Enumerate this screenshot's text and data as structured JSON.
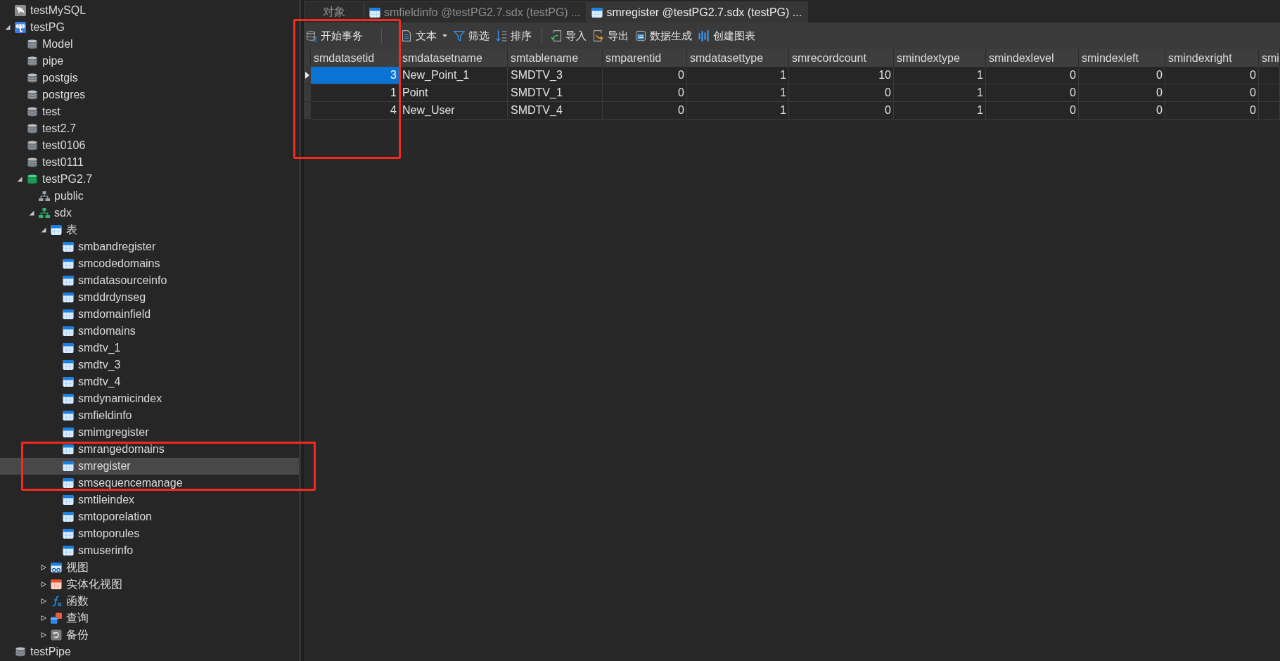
{
  "sidebar": {
    "tree": [
      {
        "label": "testMySQL",
        "kind": "mysql",
        "selected": false
      },
      {
        "label": "testPG",
        "kind": "postgres",
        "expanded": true,
        "selected": false,
        "children": [
          {
            "label": "Model",
            "kind": "database",
            "open": false,
            "selected": false
          },
          {
            "label": "pipe",
            "kind": "database",
            "open": false,
            "selected": false
          },
          {
            "label": "postgis",
            "kind": "database",
            "open": false,
            "selected": false
          },
          {
            "label": "postgres",
            "kind": "database",
            "open": false,
            "selected": false
          },
          {
            "label": "test",
            "kind": "database",
            "open": false,
            "selected": false
          },
          {
            "label": "test2.7",
            "kind": "database",
            "open": false,
            "selected": false
          },
          {
            "label": "test0106",
            "kind": "database",
            "open": false,
            "selected": false
          },
          {
            "label": "test0111",
            "kind": "database",
            "open": false,
            "selected": false
          },
          {
            "label": "testPG2.7",
            "kind": "database",
            "open": true,
            "expanded": true,
            "selected": false,
            "children": [
              {
                "label": "public",
                "kind": "schema",
                "open": false,
                "selected": false
              },
              {
                "label": "sdx",
                "kind": "schema",
                "open": true,
                "expanded": true,
                "selected": false,
                "children": [
                  {
                    "label": "表",
                    "kind": "tables",
                    "expanded": true,
                    "selected": false,
                    "children": [
                      {
                        "label": "smbandregister",
                        "kind": "table",
                        "selected": false
                      },
                      {
                        "label": "smcodedomains",
                        "kind": "table",
                        "selected": false
                      },
                      {
                        "label": "smdatasourceinfo",
                        "kind": "table",
                        "selected": false
                      },
                      {
                        "label": "smddrdynseg",
                        "kind": "table",
                        "selected": false
                      },
                      {
                        "label": "smdomainfield",
                        "kind": "table",
                        "selected": false
                      },
                      {
                        "label": "smdomains",
                        "kind": "table",
                        "selected": false
                      },
                      {
                        "label": "smdtv_1",
                        "kind": "table",
                        "selected": false
                      },
                      {
                        "label": "smdtv_3",
                        "kind": "table",
                        "selected": false
                      },
                      {
                        "label": "smdtv_4",
                        "kind": "table",
                        "selected": false
                      },
                      {
                        "label": "smdynamicindex",
                        "kind": "table",
                        "selected": false
                      },
                      {
                        "label": "smfieldinfo",
                        "kind": "table",
                        "selected": false
                      },
                      {
                        "label": "smimgregister",
                        "kind": "table",
                        "selected": false
                      },
                      {
                        "label": "smrangedomains",
                        "kind": "table",
                        "selected": false
                      },
                      {
                        "label": "smregister",
                        "kind": "table",
                        "selected": true
                      },
                      {
                        "label": "smsequencemanage",
                        "kind": "table",
                        "selected": false
                      },
                      {
                        "label": "smtileindex",
                        "kind": "table",
                        "selected": false
                      },
                      {
                        "label": "smtoporelation",
                        "kind": "table",
                        "selected": false
                      },
                      {
                        "label": "smtoporules",
                        "kind": "table",
                        "selected": false
                      },
                      {
                        "label": "smuserinfo",
                        "kind": "table",
                        "selected": false
                      }
                    ]
                  },
                  {
                    "label": "视图",
                    "kind": "views",
                    "expanded": false,
                    "selected": false
                  },
                  {
                    "label": "实体化视图",
                    "kind": "matviews",
                    "expanded": false,
                    "selected": false
                  },
                  {
                    "label": "函数",
                    "kind": "functions",
                    "expanded": false,
                    "selected": false
                  },
                  {
                    "label": "查询",
                    "kind": "queries",
                    "expanded": false,
                    "selected": false
                  },
                  {
                    "label": "备份",
                    "kind": "backups",
                    "expanded": false,
                    "selected": false
                  }
                ]
              }
            ]
          }
        ]
      },
      {
        "label": "testPipe",
        "kind": "database",
        "open": false,
        "selected": false
      }
    ]
  },
  "tabs": [
    {
      "label": "对象",
      "kind": "objects",
      "selected": false
    },
    {
      "label": "smfieldinfo @testPG2.7.sdx (testPG) ...",
      "kind": "table",
      "selected": false
    },
    {
      "label": "smregister @testPG2.7.sdx (testPG) ...",
      "kind": "table",
      "selected": true
    }
  ],
  "toolbar": {
    "groups": [
      [
        {
          "label": "开始事务",
          "kind": "transaction",
          "dropdown": false
        }
      ],
      [
        {
          "label": "文本",
          "kind": "text",
          "dropdown": true
        },
        {
          "label": "筛选",
          "kind": "filter",
          "dropdown": false
        },
        {
          "label": "排序",
          "kind": "sort",
          "dropdown": false
        }
      ],
      [
        {
          "label": "导入",
          "kind": "import",
          "dropdown": false
        },
        {
          "label": "导出",
          "kind": "export",
          "dropdown": false
        },
        {
          "label": "数据生成",
          "kind": "generate",
          "dropdown": false
        },
        {
          "label": "创建图表",
          "kind": "chart",
          "dropdown": false
        }
      ]
    ]
  },
  "table": {
    "columns": [
      {
        "name": "smdatasetid",
        "kind": "number"
      },
      {
        "name": "smdatasetname",
        "kind": "text"
      },
      {
        "name": "smtablename",
        "kind": "text"
      },
      {
        "name": "smparentid",
        "kind": "number"
      },
      {
        "name": "smdatasettype",
        "kind": "number"
      },
      {
        "name": "smrecordcount",
        "kind": "number"
      },
      {
        "name": "smindextype",
        "kind": "number"
      },
      {
        "name": "smindexlevel",
        "kind": "number"
      },
      {
        "name": "smindexleft",
        "kind": "number"
      },
      {
        "name": "smindexright",
        "kind": "number"
      },
      {
        "name": "smi"
      }
    ],
    "rows": [
      {
        "selected": true,
        "cells": [
          "3",
          "New_Point_1",
          "SMDTV_3",
          "0",
          "1",
          "10",
          "1",
          "0",
          "0",
          "0"
        ]
      },
      {
        "selected": false,
        "cells": [
          "1",
          "Point",
          "SMDTV_1",
          "0",
          "1",
          "0",
          "1",
          "0",
          "0",
          "0"
        ]
      },
      {
        "selected": false,
        "cells": [
          "4",
          "New_User",
          "SMDTV_4",
          "0",
          "1",
          "0",
          "1",
          "0",
          "0",
          "0"
        ]
      }
    ]
  },
  "annotations": [
    {
      "kind": "frame"
    },
    {
      "kind": "frame"
    }
  ]
}
